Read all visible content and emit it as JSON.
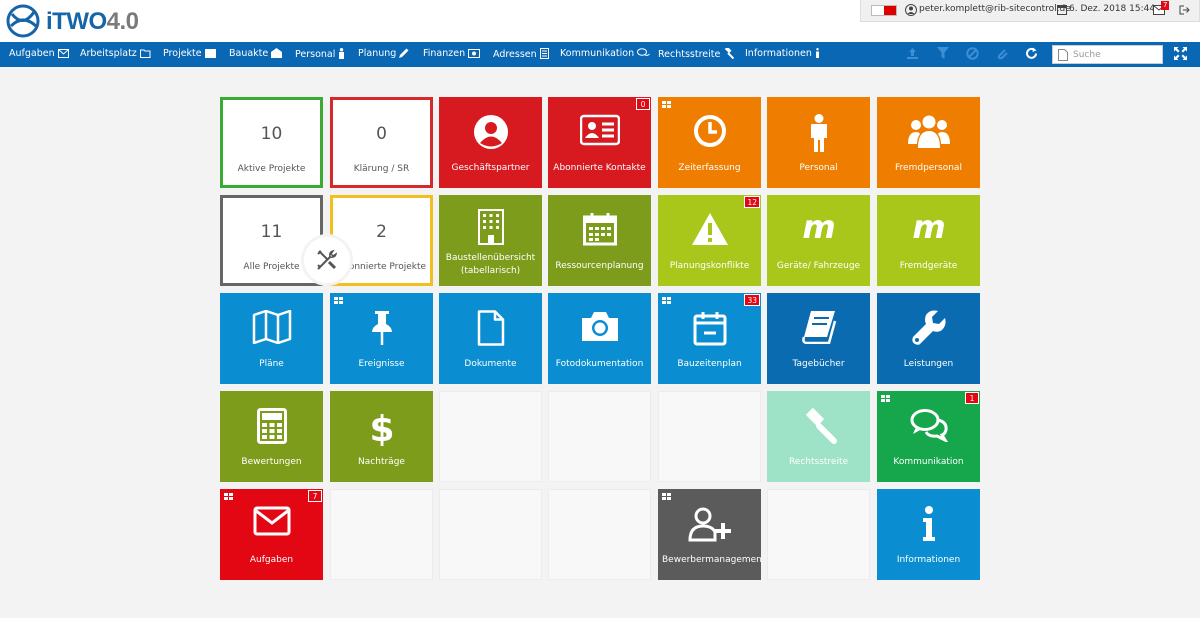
{
  "app": {
    "logo_text": "iTWO",
    "logo_version": "4.0"
  },
  "topbar": {
    "user": "peter.komplett@rib-sitecontrol.de",
    "datetime": "6. Dez. 2018 15:44",
    "mail_badge": "7"
  },
  "nav": {
    "items": [
      "Aufgaben",
      "Arbeitsplatz",
      "Projekte",
      "Bauakte",
      "Personal",
      "Planung",
      "Finanzen",
      "Adressen",
      "Kommunikation",
      "Rechtsstreite",
      "Informationen"
    ],
    "search_placeholder": "Suche"
  },
  "stats": [
    {
      "value": "10",
      "label": "Aktive Projekte",
      "color": "#3aaa35"
    },
    {
      "value": "0",
      "label": "Klärung / SR",
      "color": "#d62a2a"
    },
    {
      "value": "11",
      "label": "Alle Projekte",
      "color": "#666666"
    },
    {
      "value": "2",
      "label": "Abonnierte Projekte",
      "color": "#f0c020"
    }
  ],
  "tiles": {
    "geschaeftspartner": {
      "label": "Geschäftspartner"
    },
    "abonnierte_kontakte": {
      "label": "Abonnierte Kontakte",
      "badge": "0"
    },
    "zeiterfassung": {
      "label": "Zeiterfassung"
    },
    "personal": {
      "label": "Personal"
    },
    "fremdpersonal": {
      "label": "Fremdpersonal"
    },
    "baustellenuebersicht": {
      "label": "Baustellenübersicht (tabellarisch)"
    },
    "ressourcenplanung": {
      "label": "Ressourcenplanung"
    },
    "planungskonflikte": {
      "label": "Planungskonflikte",
      "badge": "12"
    },
    "geraete": {
      "label": "Geräte/ Fahrzeuge"
    },
    "fremdgeraete": {
      "label": "Fremdgeräte"
    },
    "plaene": {
      "label": "Pläne"
    },
    "ereignisse": {
      "label": "Ereignisse"
    },
    "dokumente": {
      "label": "Dokumente"
    },
    "fotodokumentation": {
      "label": "Fotodokumentation"
    },
    "bauzeitenplan": {
      "label": "Bauzeitenplan",
      "badge": "33"
    },
    "tagebuecher": {
      "label": "Tagebücher"
    },
    "leistungen": {
      "label": "Leistungen"
    },
    "bewertungen": {
      "label": "Bewertungen"
    },
    "nachtraege": {
      "label": "Nachträge"
    },
    "rechtsstreite": {
      "label": "Rechtsstreite"
    },
    "kommunikation": {
      "label": "Kommunikation",
      "badge": "1"
    },
    "aufgaben": {
      "label": "Aufgaben",
      "badge": "7"
    },
    "bewerbermanagement": {
      "label": "Bewerbermanagement"
    },
    "informationen": {
      "label": "Informationen"
    }
  },
  "colors": {
    "red": "#d71920",
    "orange": "#ef7d00",
    "lime": "#a9c61b",
    "olive": "#7e9c1b",
    "blue": "#0a8ed1",
    "darkblue": "#0a6bb0",
    "green": "#16a64b",
    "mint": "#9ee2c8",
    "gray": "#5b5b5b"
  }
}
